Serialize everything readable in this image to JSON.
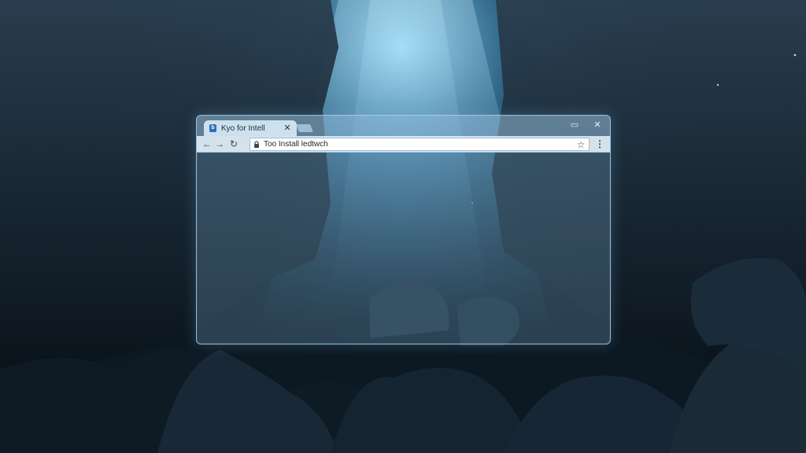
{
  "browser": {
    "tab": {
      "favicon": "b",
      "title": "Kyo for Intell",
      "close_icon": "close-icon"
    },
    "window_controls": {
      "minimize": "▭",
      "close": "✕"
    },
    "toolbar": {
      "back": "←",
      "forward": "→",
      "reload": "↻",
      "url": "Too Install ledtwch",
      "bookmark": "☆",
      "menu": "⋮"
    }
  },
  "colors": {
    "accent": "#2a6fb8",
    "window_border": "#aacdeb",
    "toolbar_bg": "#e1eef8"
  }
}
